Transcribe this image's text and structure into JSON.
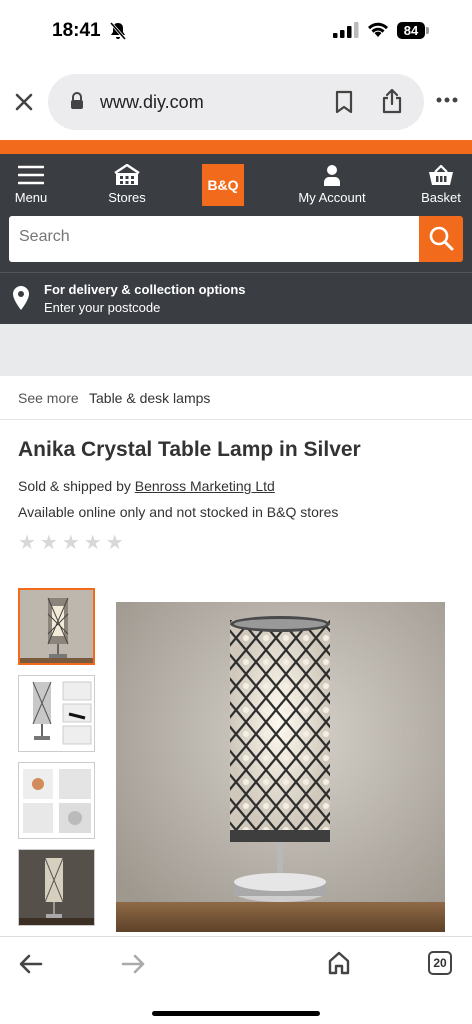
{
  "status": {
    "time": "18:41",
    "battery": "84"
  },
  "browser": {
    "url": "www.diy.com"
  },
  "nav": {
    "menu_label": "Menu",
    "stores_label": "Stores",
    "logo_text": "B&Q",
    "account_label": "My Account",
    "basket_label": "Basket"
  },
  "search": {
    "placeholder": "Search"
  },
  "delivery": {
    "title": "For delivery & collection options",
    "subtitle": "Enter your postcode"
  },
  "breadcrumb": {
    "prefix": "See more",
    "link": "Table & desk lamps"
  },
  "product": {
    "title": "Anika Crystal Table Lamp in Silver",
    "sold_prefix": "Sold & shipped by",
    "seller": "Benross Marketing Ltd",
    "availability": "Available online only and not stocked in B&Q stores",
    "rating_stars": "★★★★★"
  },
  "toolbar": {
    "tabs_count": "20"
  },
  "colors": {
    "brand": "#f26b1d",
    "header": "#3a3e42"
  }
}
